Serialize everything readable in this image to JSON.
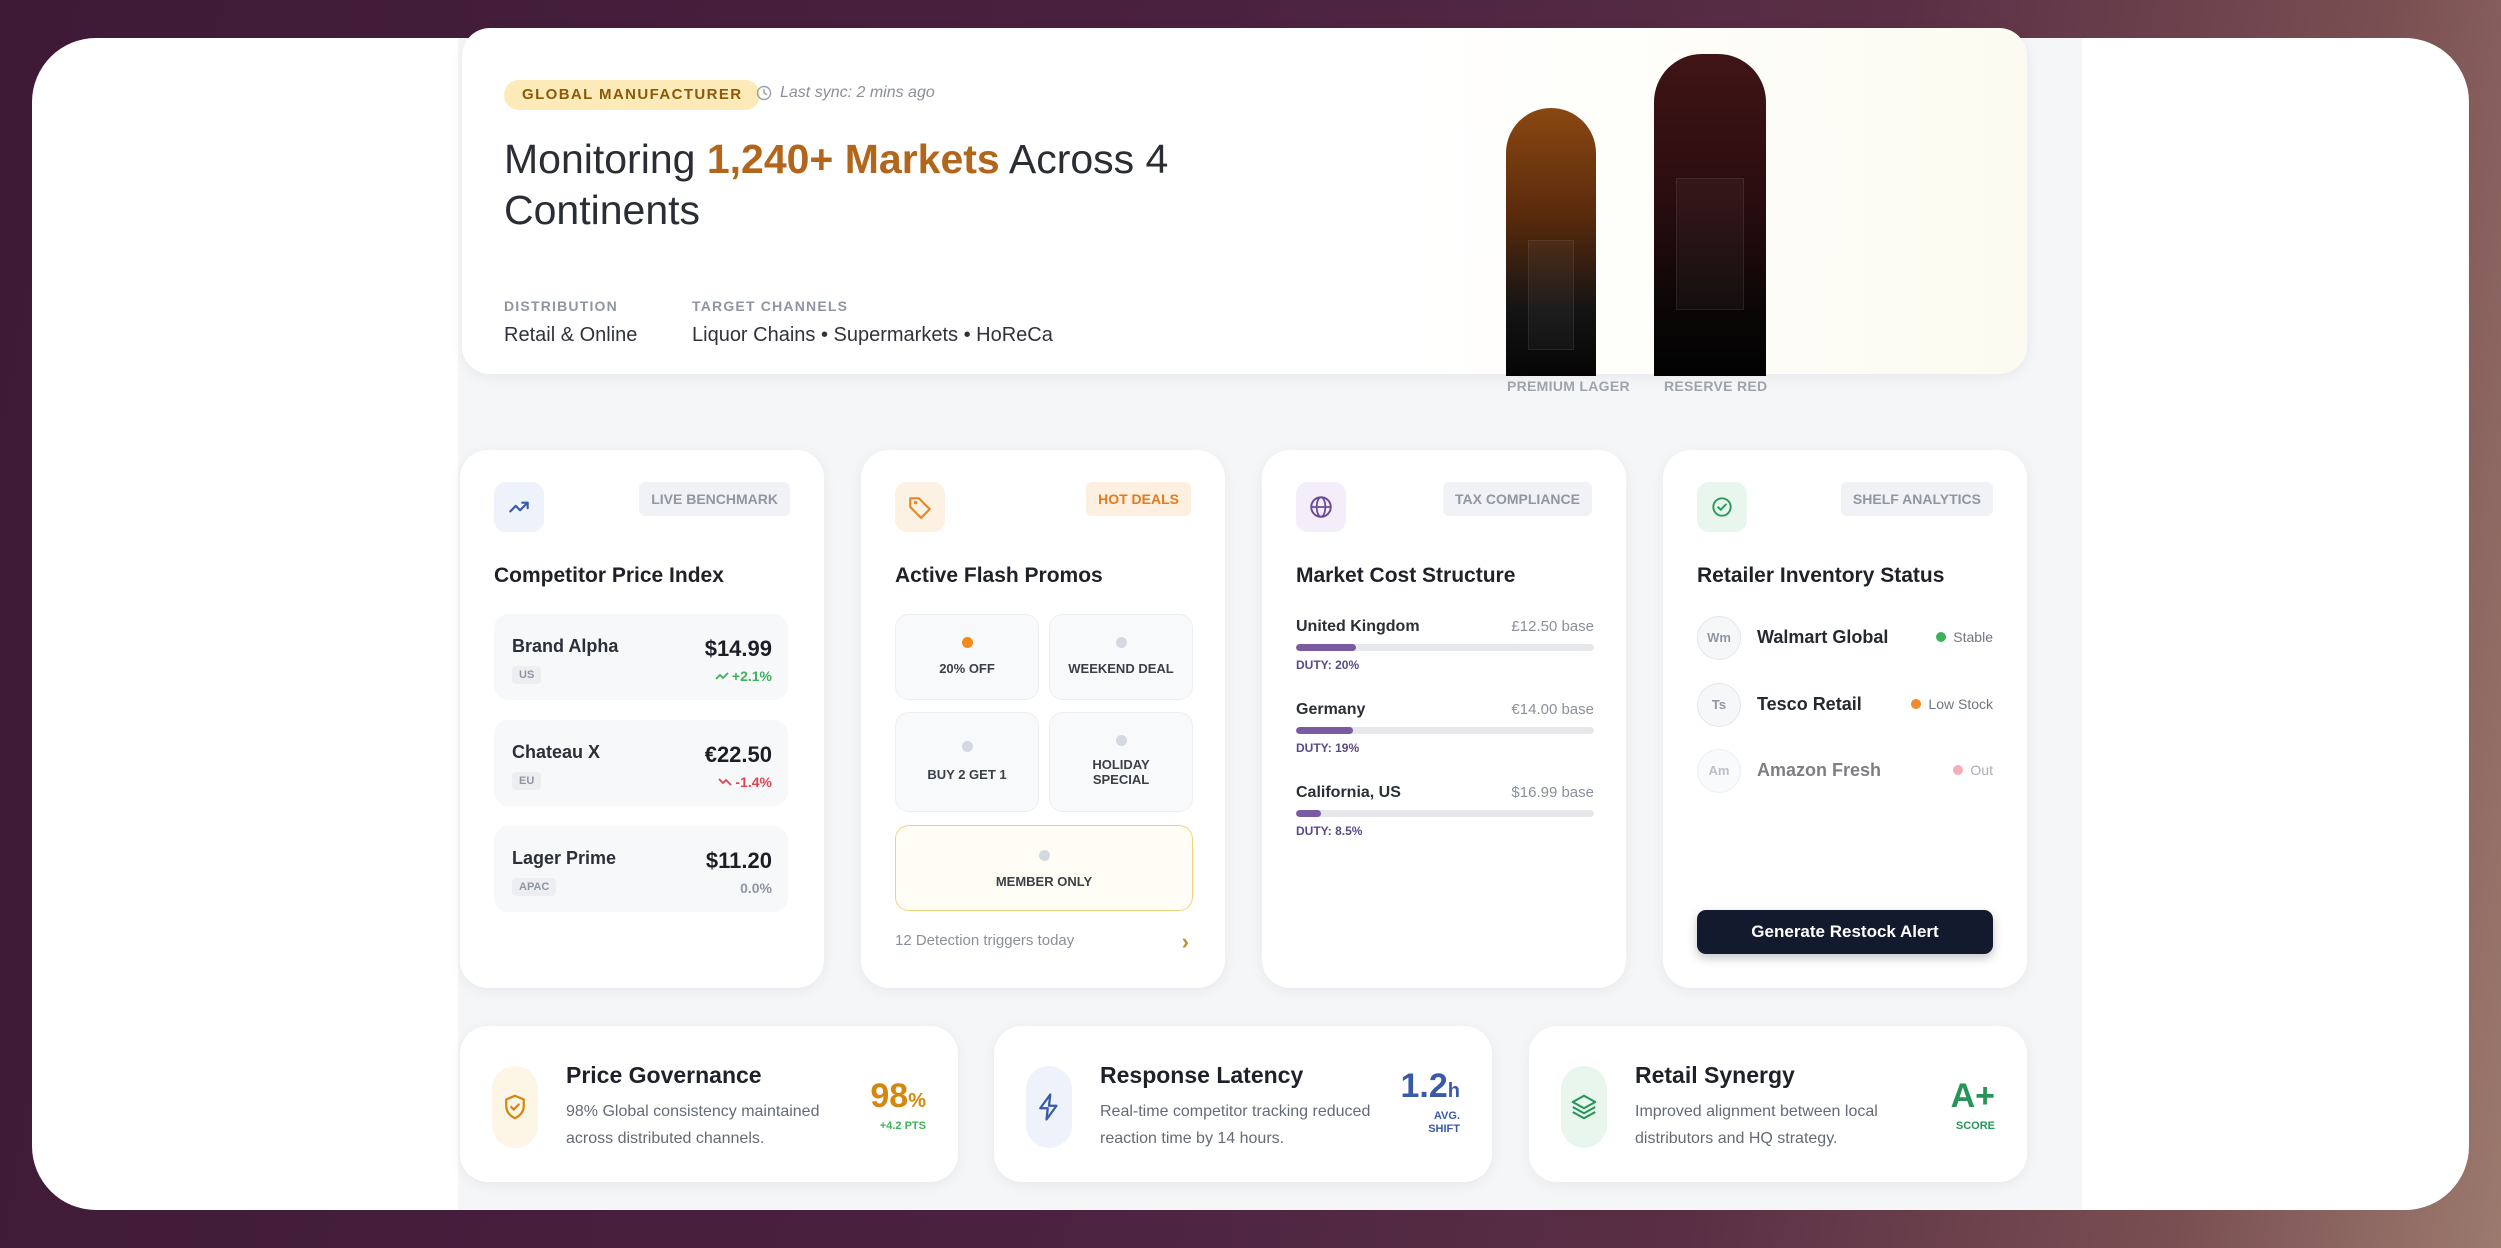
{
  "hero": {
    "tag": "GLOBAL MANUFACTURER",
    "sync": "Last sync: 2 mins ago",
    "headline_pre": "Monitoring ",
    "headline_highlight": "1,240+ Markets",
    "headline_post": " Across 4 Continents",
    "distribution_label": "DISTRIBUTION",
    "distribution_value": "Retail & Online",
    "channels_label": "TARGET CHANNELS",
    "channels_value": "Liquor Chains • Supermarkets • HoReCa",
    "bottles": [
      {
        "name": "PREMIUM LAGER",
        "color": "#7a3d12"
      },
      {
        "name": "RESERVE RED",
        "color": "#3b1114"
      }
    ]
  },
  "cards": {
    "benchmark": {
      "badge": "LIVE BENCHMARK",
      "title": "Competitor Price Index",
      "icon": "trend-up-icon",
      "rows": [
        {
          "name": "Brand Alpha",
          "region": "US",
          "price": "$14.99",
          "change": "+2.1%",
          "direction": "up"
        },
        {
          "name": "Chateau X",
          "region": "EU",
          "price": "€22.50",
          "change": "-1.4%",
          "direction": "down"
        },
        {
          "name": "Lager Prime",
          "region": "APAC",
          "price": "$11.20",
          "change": "0.0%",
          "direction": "flat"
        }
      ]
    },
    "promos": {
      "badge": "HOT DEALS",
      "title": "Active Flash Promos",
      "icon": "tag-icon",
      "items": [
        {
          "label": "20% OFF",
          "active": true
        },
        {
          "label": "WEEKEND DEAL",
          "active": false
        },
        {
          "label": "BUY 2 GET 1",
          "active": false
        },
        {
          "label": "HOLIDAY SPECIAL",
          "active": false
        },
        {
          "label": "MEMBER ONLY",
          "active": false
        }
      ],
      "footer": "12 Detection triggers today"
    },
    "cost": {
      "badge": "TAX COMPLIANCE",
      "title": "Market Cost Structure",
      "icon": "globe-icon",
      "rows": [
        {
          "country": "United Kingdom",
          "base": "£12.50 base",
          "duty": "DUTY: 20%",
          "duty_pct": 20
        },
        {
          "country": "Germany",
          "base": "€14.00 base",
          "duty": "DUTY: 19%",
          "duty_pct": 19
        },
        {
          "country": "California, US",
          "base": "$16.99 base",
          "duty": "DUTY: 8.5%",
          "duty_pct": 8.5
        }
      ]
    },
    "inventory": {
      "badge": "SHELF ANALYTICS",
      "title": "Retailer Inventory Status",
      "icon": "check-circle-icon",
      "rows": [
        {
          "initials": "Wm",
          "name": "Walmart Global",
          "status": "Stable",
          "color": "#3bb35a"
        },
        {
          "initials": "Ts",
          "name": "Tesco Retail",
          "status": "Low Stock",
          "color": "#f08a2a"
        },
        {
          "initials": "Am",
          "name": "Amazon Fresh",
          "status": "Out",
          "color": "#f07a8a"
        }
      ],
      "button": "Generate Restock Alert"
    }
  },
  "kpis": [
    {
      "title": "Price Governance",
      "desc": "98% Global consistency maintained across distributed channels.",
      "value": "98",
      "unit": "%",
      "sub": "+4.2 PTS",
      "color": "#d4870f",
      "icon": "shield-check-icon"
    },
    {
      "title": "Response Latency",
      "desc": "Real-time competitor tracking reduced reaction time by 14 hours.",
      "value": "1.2",
      "unit": "h",
      "sub": "AVG. SHIFT",
      "color": "#3a5aa8",
      "icon": "lightning-icon"
    },
    {
      "title": "Retail Synergy",
      "desc": "Improved alignment between local distributors and HQ strategy.",
      "value": "A+",
      "unit": "",
      "sub": "SCORE",
      "color": "#27945a",
      "icon": "layers-icon"
    }
  ]
}
